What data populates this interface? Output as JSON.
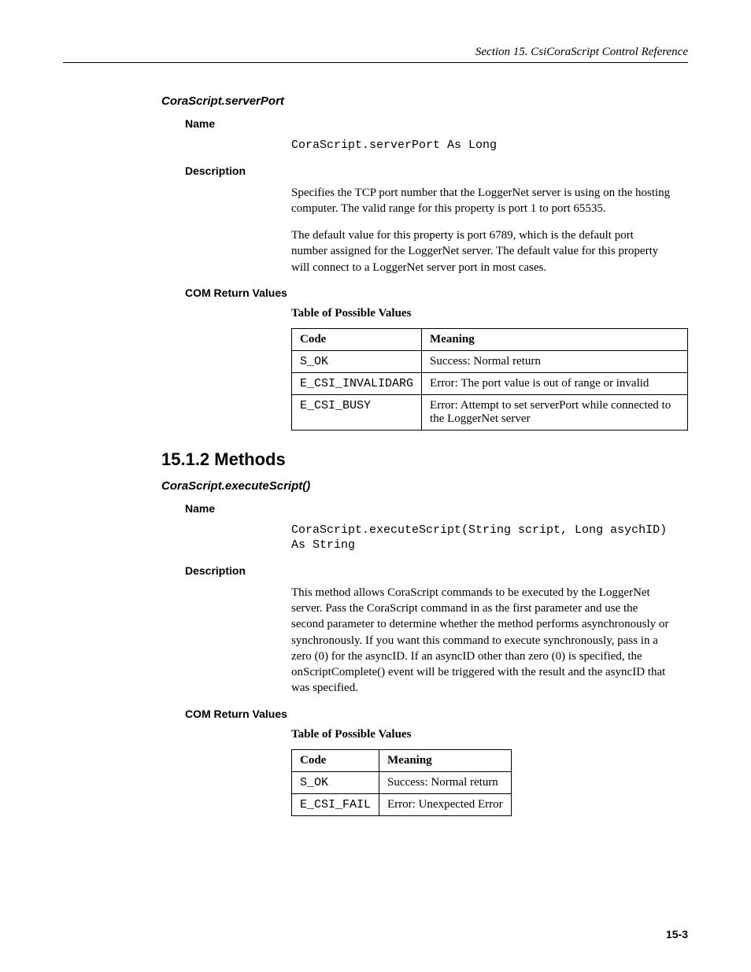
{
  "header": "Section 15.  CsiCoraScript Control Reference",
  "section1": {
    "title": "CoraScript.serverPort",
    "nameLabel": "Name",
    "nameCode": "CoraScript.serverPort As Long",
    "descLabel": "Description",
    "descP1": "Specifies the TCP port number that the LoggerNet server is using on the hosting computer.  The valid range for this property is port 1 to port 65535.",
    "descP2": "The default value for this property is port 6789, which is the default port number assigned for the LoggerNet server.  The default value for this property will connect to a LoggerNet server port in most cases.",
    "comLabel": "COM Return Values",
    "tableCaption": "Table of Possible Values",
    "tableHead": {
      "c1": "Code",
      "c2": "Meaning"
    },
    "rows": [
      {
        "code": "S_OK",
        "meaning": "Success: Normal return"
      },
      {
        "code": "E_CSI_INVALIDARG",
        "meaning": "Error: The port value is out of range or invalid"
      },
      {
        "code": "E_CSI_BUSY",
        "meaning": "Error: Attempt to set serverPort while connected to the LoggerNet server"
      }
    ]
  },
  "methodsHeading": "15.1.2  Methods",
  "section2": {
    "title": "CoraScript.executeScript()",
    "nameLabel": "Name",
    "nameCode": "CoraScript.executeScript(String script, Long asychID) As String",
    "descLabel": "Description",
    "descP1": "This method allows CoraScript commands to be executed by the LoggerNet server.  Pass the CoraScript command in as the first parameter and use the second parameter to determine whether the method performs asynchronously or synchronously.  If you want this command to execute synchronously, pass in a zero (0) for the asyncID.  If an asyncID other than zero (0) is specified, the onScriptComplete() event will be triggered with the result and the asyncID that was specified.",
    "comLabel": "COM Return Values",
    "tableCaption": "Table of Possible Values",
    "tableHead": {
      "c1": "Code",
      "c2": "Meaning"
    },
    "rows": [
      {
        "code": "S_OK",
        "meaning": "Success: Normal return"
      },
      {
        "code": "E_CSI_FAIL",
        "meaning": "Error: Unexpected Error"
      }
    ]
  },
  "pageNum": "15-3"
}
